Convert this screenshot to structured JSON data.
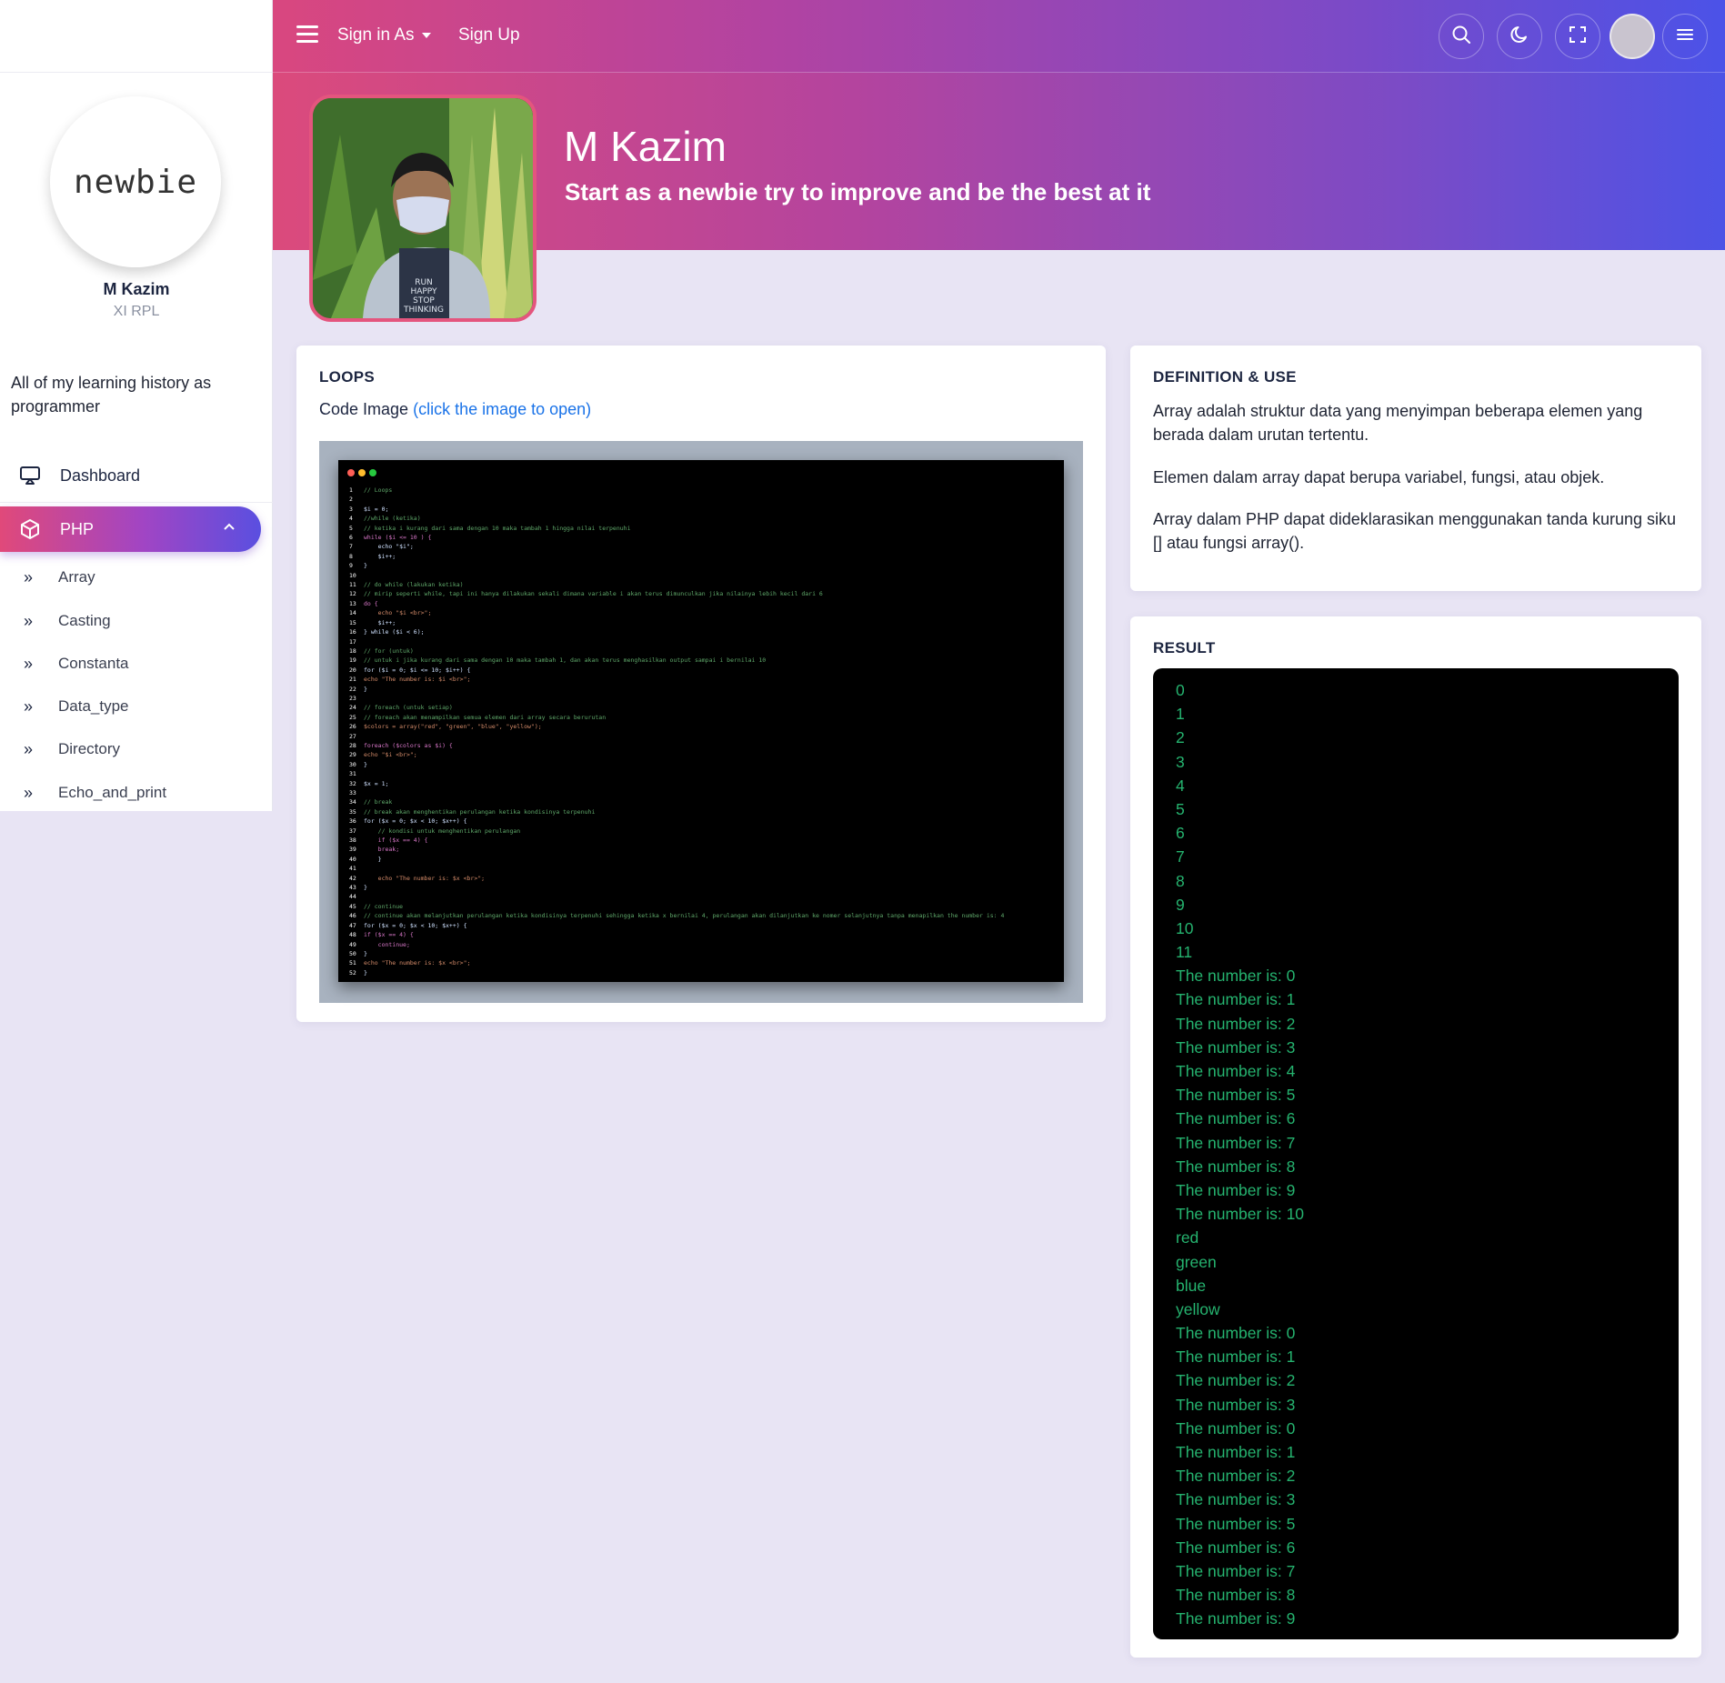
{
  "sidebar": {
    "logo_text": "newbie",
    "user_name": "M Kazim",
    "user_class": "XI RPL",
    "description": "All of my learning history as programmer",
    "nav": {
      "dashboard": "Dashboard",
      "php": "PHP"
    },
    "sub_items": [
      "Array",
      "Casting",
      "Constanta",
      "Data_type",
      "Directory",
      "Echo_and_print"
    ]
  },
  "topbar": {
    "sign_in": "Sign in As",
    "sign_up": "Sign Up"
  },
  "hero": {
    "title": "M Kazim",
    "subtitle": "Start as a newbie try to improve and be the best at it"
  },
  "loops": {
    "title": "LOOPS",
    "code_label": "Code Image",
    "code_link": "(click the image to open)"
  },
  "definition": {
    "title": "DEFINITION & USE",
    "p1": "Array adalah struktur data yang menyimpan beberapa elemen yang berada dalam urutan tertentu.",
    "p2": "Elemen dalam array dapat berupa variabel, fungsi, atau objek.",
    "p3": "Array dalam PHP dapat dideklarasikan menggunakan tanda kurung siku [] atau fungsi array()."
  },
  "result": {
    "title": "RESULT",
    "lines": [
      "0",
      "1",
      "2",
      "3",
      "4",
      "5",
      "6",
      "7",
      "8",
      "9",
      "10",
      "11",
      "The number is: 0",
      "The number is: 1",
      "The number is: 2",
      "The number is: 3",
      "The number is: 4",
      "The number is: 5",
      "The number is: 6",
      "The number is: 7",
      "The number is: 8",
      "The number is: 9",
      "The number is: 10",
      "red",
      "green",
      "blue",
      "yellow",
      "The number is: 0",
      "The number is: 1",
      "The number is: 2",
      "The number is: 3",
      "The number is: 0",
      "The number is: 1",
      "The number is: 2",
      "The number is: 3",
      "The number is: 5",
      "The number is: 6",
      "The number is: 7",
      "The number is: 8",
      "The number is: 9"
    ]
  },
  "code_image": {
    "lines": [
      [
        "// Loops",
        "cm"
      ],
      [
        "",
        ""
      ],
      [
        "$i = 0;",
        "vr"
      ],
      [
        "//while (ketika)",
        "cm"
      ],
      [
        "// ketika i kurang dari sama dengan 10 maka tambah 1 hingga nilai terpenuhi",
        "cm"
      ],
      [
        "while ($i <= 10 ) {",
        "kw"
      ],
      [
        "    echo \"$i\";",
        "vr"
      ],
      [
        "    $i++;",
        "vr"
      ],
      [
        "}",
        "vr"
      ],
      [
        "",
        ""
      ],
      [
        "// do while (lakukan ketika)",
        "cm"
      ],
      [
        "// mirip seperti while, tapi ini hanya dilakukan sekali dimana variable i akan terus dimunculkan jika nilainya lebih kecil dari 6",
        "cm"
      ],
      [
        "do {",
        "kw"
      ],
      [
        "    echo \"$i <br>\";",
        "st"
      ],
      [
        "    $i++;",
        "vr"
      ],
      [
        "} while ($i < 6);",
        "vr"
      ],
      [
        "",
        ""
      ],
      [
        "// for (untuk)",
        "cm"
      ],
      [
        "// untuk i jika kurang dari sama dengan 10 maka tambah 1, dan akan terus menghasilkan output sampai i bernilai 10",
        "cm"
      ],
      [
        "for ($i = 0; $i <= 10; $i++) {",
        "vr"
      ],
      [
        "echo \"The number is: $i <br>\";",
        "st"
      ],
      [
        "}",
        "vr"
      ],
      [
        "",
        ""
      ],
      [
        "// foreach (untuk setiap)",
        "cm"
      ],
      [
        "// foreach akan menampilkan semua elemen dari array secara berurutan",
        "cm"
      ],
      [
        "$colors = array(\"red\", \"green\", \"blue\", \"yellow\");",
        "st"
      ],
      [
        "",
        ""
      ],
      [
        "foreach ($colors as $i) {",
        "kw"
      ],
      [
        "echo \"$i <br>\";",
        "st"
      ],
      [
        "}",
        "vr"
      ],
      [
        "",
        ""
      ],
      [
        "$x = 1;",
        "vr"
      ],
      [
        "",
        ""
      ],
      [
        "// break",
        "cm"
      ],
      [
        "// break akan menghentikan perulangan ketika kondisinya terpenuhi",
        "cm"
      ],
      [
        "for ($x = 0; $x < 10; $x++) {",
        "vr"
      ],
      [
        "    // kondisi untuk menghentikan perulangan",
        "cm"
      ],
      [
        "    if ($x == 4) {",
        "kw"
      ],
      [
        "    break;",
        "kw"
      ],
      [
        "    }",
        "vr"
      ],
      [
        "",
        ""
      ],
      [
        "    echo \"The number is: $x <br>\";",
        "st"
      ],
      [
        "}",
        "vr"
      ],
      [
        "",
        ""
      ],
      [
        "// continue",
        "cm"
      ],
      [
        "// continue akan melanjutkan perulangan ketika kondisinya terpenuhi sehingga ketika x bernilai 4, perulangan akan dilanjutkan ke nomer selanjutnya tanpa menapilkan the number is: 4",
        "cm"
      ],
      [
        "for ($x = 0; $x < 10; $x++) {",
        "vr"
      ],
      [
        "if ($x == 4) {",
        "kw"
      ],
      [
        "    continue;",
        "kw"
      ],
      [
        "}",
        "vr"
      ],
      [
        "echo \"The number is: $x <br>\";",
        "st"
      ],
      [
        "}",
        "vr"
      ]
    ]
  }
}
